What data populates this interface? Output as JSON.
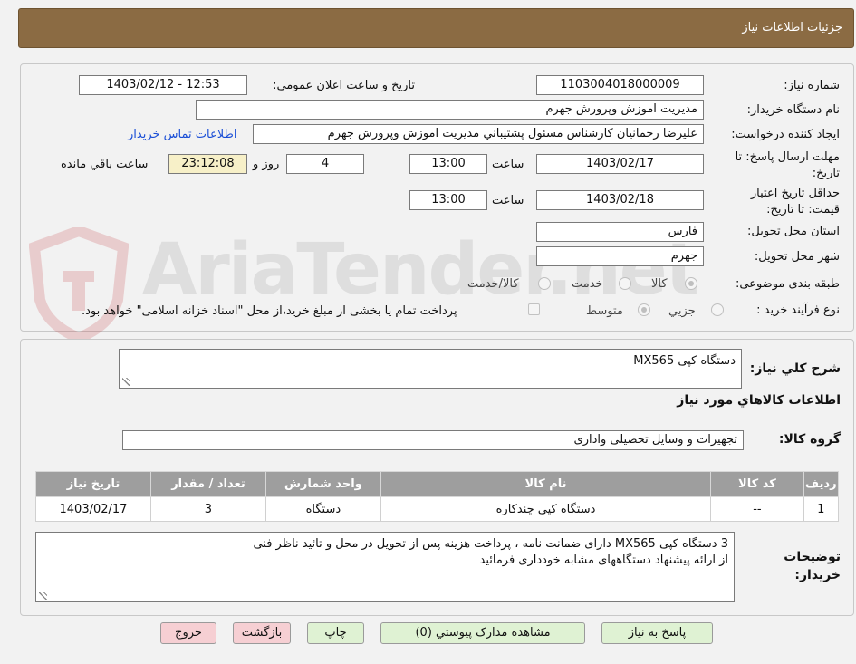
{
  "header": {
    "title": "جزئيات اطلاعات نياز"
  },
  "watermark": {
    "text": "AriaTender.net"
  },
  "form": {
    "need_number": {
      "label": "شماره نياز:",
      "value": "1103004018000009"
    },
    "announce_datetime": {
      "label": "تاريخ و ساعت اعلان عمومي:",
      "value": "1403/02/12 - 12:53"
    },
    "buyer_org": {
      "label": "نام دستگاه خريدار:",
      "value": "مديريت اموزش وپرورش جهرم"
    },
    "requester": {
      "label": "ايجاد كننده درخواست:",
      "value": "عليرضا رحمانيان كارشناس مسئول پشتيباني مديريت اموزش وپرورش جهرم"
    },
    "buyer_contact_link": "اطلاعات تماس خريدار",
    "reply_deadline": {
      "label": "مهلت ارسال پاسخ: تا تاريخ:",
      "date": "1403/02/17",
      "time_label": "ساعت",
      "time": "13:00",
      "days": "4",
      "days_label": "روز و",
      "remaining": "23:12:08",
      "remaining_label": "ساعت باقي مانده"
    },
    "price_validity": {
      "label": "حداقل تاريخ اعتبار قيمت: تا تاريخ:",
      "date": "1403/02/18",
      "time_label": "ساعت",
      "time": "13:00"
    },
    "delivery_province": {
      "label": "استان محل تحويل:",
      "value": "فارس"
    },
    "delivery_city": {
      "label": "شهر محل تحويل:",
      "value": "جهرم"
    },
    "subject_category": {
      "label": "طبقه بندی موضوعی:",
      "options": [
        "كالا",
        "خدمت",
        "كالا/خدمت"
      ],
      "selected": "كالا"
    },
    "purchase_process": {
      "label": "نوع فرآيند خريد :",
      "options": [
        "جزيي",
        "متوسط"
      ],
      "selected": "متوسط",
      "payment_note": "پرداخت تمام يا بخشی از مبلغ خريد،از محل \"اسناد خزانه اسلامی\" خواهد بود."
    }
  },
  "details": {
    "general_desc": {
      "label": "شرح كلي نياز:",
      "value": "دستگاه کپی MX565"
    },
    "goods_info_title": "اطلاعات كالاهاي مورد نياز",
    "goods_group": {
      "label": "گروه كالا:",
      "value": "تجهيزات و وسايل تحصيلی واداری"
    },
    "table": {
      "headers": [
        "رديف",
        "كد كالا",
        "نام كالا",
        "واحد شمارش",
        "تعداد / مقدار",
        "تاريخ نياز"
      ],
      "rows": [
        [
          "1",
          "--",
          "دستگاه کپی چندکاره",
          "دستگاه",
          "3",
          "1403/02/17"
        ]
      ]
    },
    "buyer_notes": {
      "label": "توضيحات خريدار:",
      "lines": [
        "3 دستگاه کپی MX565 دارای ضمانت نامه ، پرداخت هزينه پس از تحويل در محل و تائيد ناظر فنی",
        "از ارائه پيشنهاد دستگاههای مشابه خودداری فرمائيد"
      ]
    }
  },
  "buttons": {
    "reply": "پاسخ به نياز",
    "attachments": "مشاهده مدارک پيوستي (0)",
    "print": "چاپ",
    "back": "بازگشت",
    "exit": "خروج"
  }
}
